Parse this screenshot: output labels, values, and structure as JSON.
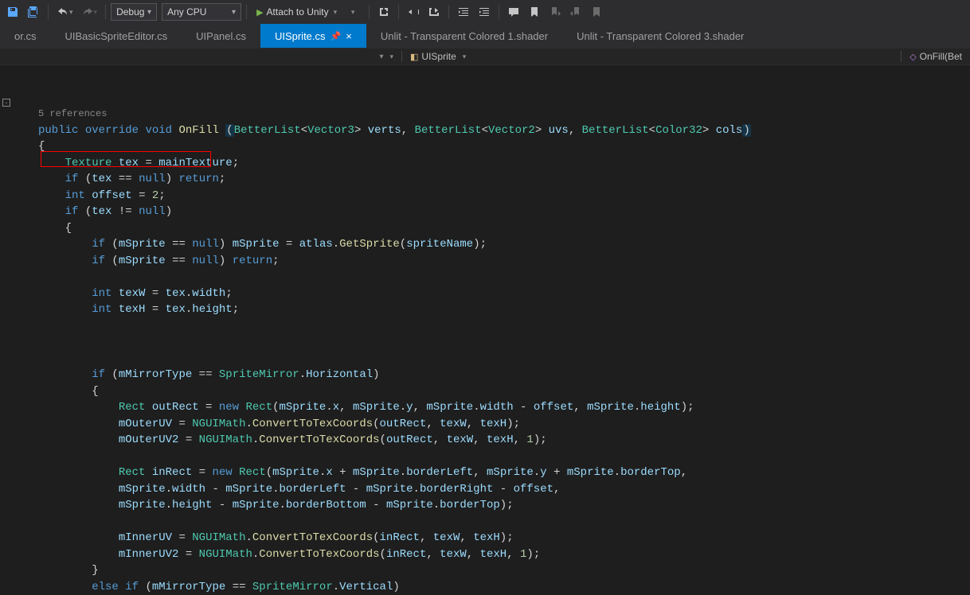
{
  "toolbar": {
    "config": "Debug",
    "platform": "Any CPU",
    "attach": "Attach to Unity"
  },
  "tabs": [
    {
      "label": "or.cs"
    },
    {
      "label": "UIBasicSpriteEditor.cs"
    },
    {
      "label": "UIPanel.cs"
    },
    {
      "label": "UISprite.cs",
      "active": true
    },
    {
      "label": "Unlit - Transparent Colored 1.shader"
    },
    {
      "label": "Unlit - Transparent Colored 3.shader"
    }
  ],
  "navbar": {
    "class": "UISprite",
    "method": "OnFill(Bet"
  },
  "code": {
    "references": "5 references",
    "signature": {
      "pub": "public",
      "override": "override",
      "void": "void",
      "name": "OnFill",
      "p1t": "BetterList",
      "p1g": "Vector3",
      "p1n": "verts",
      "p2t": "BetterList",
      "p2g": "Vector2",
      "p2n": "uvs",
      "p3t": "BetterList",
      "p3g": "Color32",
      "p3n": "cols"
    },
    "l1": {
      "type": "Texture",
      "var": "tex",
      "assign": "mainTexture"
    },
    "l2": {
      "if": "if",
      "v": "tex",
      "op": "==",
      "nul": "null",
      "ret": "return"
    },
    "l3": {
      "int": "int",
      "v": "offset",
      "eq": "=",
      "n": "2"
    },
    "l4": {
      "if": "if",
      "v": "tex",
      "op": "!=",
      "nul": "null"
    },
    "l5": {
      "if": "if",
      "v": "mSprite",
      "op": "==",
      "nul": "null",
      "v2": "mSprite",
      "atlas": "atlas",
      "get": "GetSprite",
      "sn": "spriteName"
    },
    "l6": {
      "if": "if",
      "v": "mSprite",
      "op": "==",
      "nul": "null",
      "ret": "return"
    },
    "l7": {
      "int": "int",
      "v": "texW",
      "tex": "tex",
      "w": "width"
    },
    "l8": {
      "int": "int",
      "v": "texH",
      "tex": "tex",
      "h": "height"
    },
    "l9": {
      "if": "if",
      "v": "mMirrorType",
      "op": "==",
      "sm": "SpriteMirror",
      "hor": "Horizontal"
    },
    "l10": {
      "rect": "Rect",
      "v": "outRect",
      "new": "new",
      "r": "Rect",
      "ms": "mSprite",
      "x": "x",
      "y": "y",
      "w": "width",
      "off": "offset",
      "h": "height"
    },
    "l11": {
      "v": "mOuterUV",
      "ng": "NGUIMath",
      "conv": "ConvertToTexCoords",
      "or": "outRect",
      "tw": "texW",
      "th": "texH"
    },
    "l12": {
      "v": "mOuterUV2",
      "ng": "NGUIMath",
      "conv": "ConvertToTexCoords",
      "or": "outRect",
      "tw": "texW",
      "th": "texH",
      "n": "1"
    },
    "l13": {
      "rect": "Rect",
      "v": "inRect",
      "new": "new",
      "r": "Rect",
      "ms": "mSprite",
      "x": "x",
      "bl": "borderLeft",
      "y": "y",
      "bt": "borderTop"
    },
    "l14": {
      "ms": "mSprite",
      "w": "width",
      "bl": "borderLeft",
      "br": "borderRight",
      "off": "offset"
    },
    "l15": {
      "ms": "mSprite",
      "h": "height",
      "bb": "borderBottom",
      "bt": "borderTop"
    },
    "l16": {
      "v": "mInnerUV",
      "ng": "NGUIMath",
      "conv": "ConvertToTexCoords",
      "ir": "inRect",
      "tw": "texW",
      "th": "texH"
    },
    "l17": {
      "v": "mInnerUV2",
      "ng": "NGUIMath",
      "conv": "ConvertToTexCoords",
      "ir": "inRect",
      "tw": "texW",
      "th": "texH",
      "n": "1"
    },
    "l18": {
      "else": "else",
      "if": "if",
      "v": "mMirrorType",
      "op": "==",
      "sm": "SpriteMirror",
      "ver": "Vertical"
    }
  }
}
